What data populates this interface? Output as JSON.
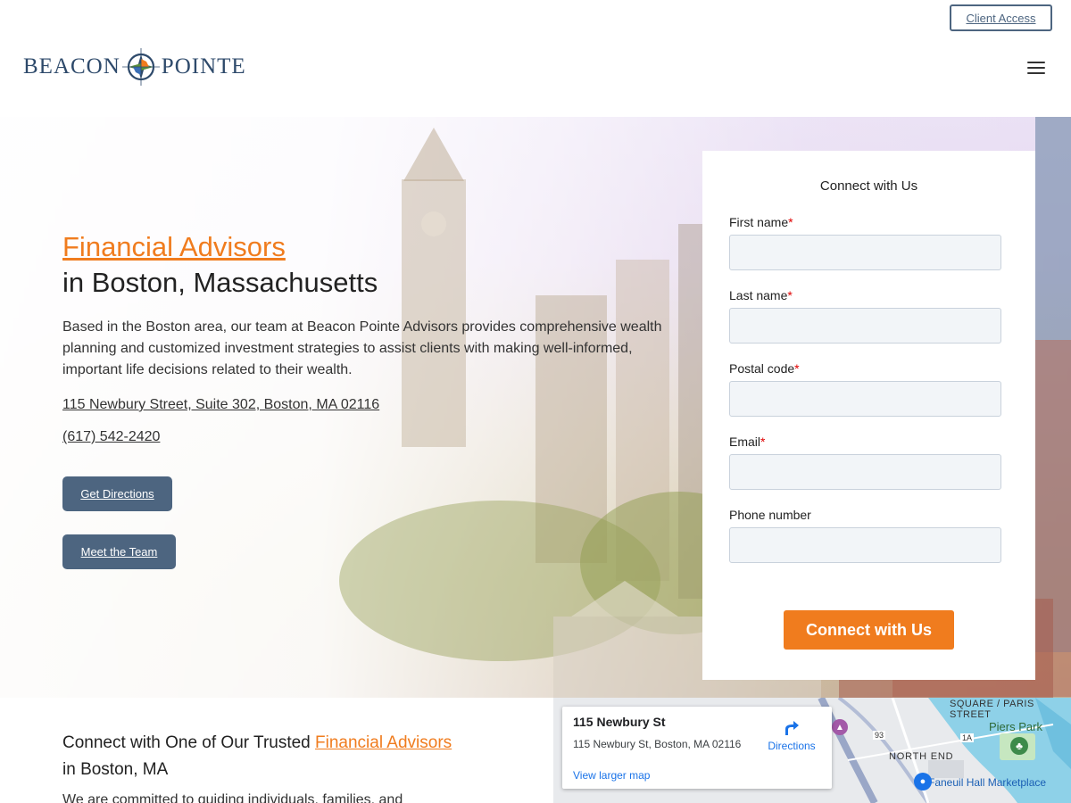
{
  "header": {
    "client_access": "Client Access",
    "logo_left": "BEACON",
    "logo_right": "POINTE"
  },
  "hero": {
    "title_accent": "Financial Advisors",
    "title_rest": "in Boston, Massachusetts",
    "description": "Based in the Boston area, our team at Beacon Pointe Advisors provides comprehensive wealth planning and customized investment strategies to assist clients with making well-informed, important life decisions related to their wealth.",
    "address": "115 Newbury Street, Suite 302, Boston, MA 02116",
    "phone": "(617) 542-2420",
    "directions_btn": "Get Directions",
    "team_btn": "Meet the Team"
  },
  "form": {
    "title": "Connect with Us",
    "fields": [
      {
        "label": "First name",
        "required": "*"
      },
      {
        "label": "Last name",
        "required": "*"
      },
      {
        "label": "Postal code",
        "required": "*"
      },
      {
        "label": "Email",
        "required": "*"
      },
      {
        "label": "Phone number",
        "required": ""
      }
    ],
    "submit": "Connect with Us"
  },
  "lower": {
    "title_start": "Connect with One of Our Trusted",
    "title_accent": "Financial Advisors",
    "title_end": "in Boston, MA",
    "text": "We are committed to guiding individuals, families, and"
  },
  "map": {
    "title": "115 Newbury St",
    "address": "115 Newbury St, Boston, MA 02116",
    "directions": "Directions",
    "larger_map": "View larger map",
    "labels": {
      "piers_park": "Piers Park",
      "north_end": "NORTH END",
      "faneuil": "Faneuil Hall Marketplace",
      "square": "SQUARE / PARIS STREET",
      "route": "93",
      "route2": "1A"
    }
  },
  "colors": {
    "accent": "#f07c1e",
    "brand_blue": "#4d6580",
    "navy": "#2e4a6b"
  }
}
